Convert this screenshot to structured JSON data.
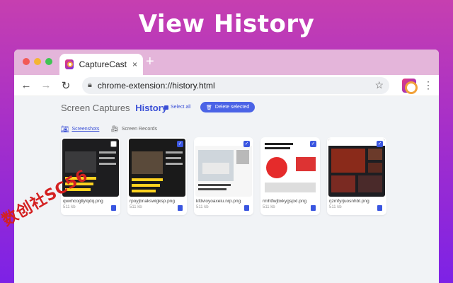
{
  "banner": {
    "title": "View History"
  },
  "browser": {
    "tab_title": "CaptureCast",
    "tab_close": "×",
    "new_tab": "+",
    "url": "chrome-extension://history.html"
  },
  "page": {
    "heading_prefix": "Screen Captures",
    "heading_active": "History",
    "select_all": "Select all",
    "delete_selected": "Delete selected",
    "subtabs": [
      {
        "label": "Screenshots",
        "active": true
      },
      {
        "label": "Screen Records",
        "active": false
      }
    ],
    "cards": [
      {
        "filename": "qwxhcogllylqdq.png",
        "size": "511 kb",
        "checked": false
      },
      {
        "filename": "rpoyjbnakswigksp.png",
        "size": "511 kb",
        "checked": true
      },
      {
        "filename": "kfdvioyoaxeiu.nrp.png",
        "size": "511 kb",
        "checked": true
      },
      {
        "filename": "rmhtfwjbxkygspxl.png",
        "size": "511 kb",
        "checked": true
      },
      {
        "filename": "rjzmfyrjuosnhbt.png",
        "size": "511 kb",
        "checked": true
      }
    ]
  },
  "watermark": "数创社SC56"
}
